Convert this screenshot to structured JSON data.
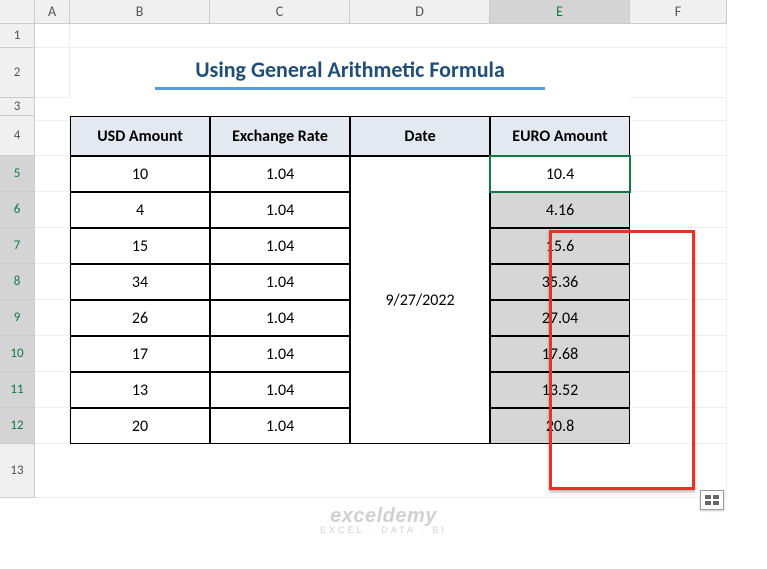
{
  "colHeaders": [
    "A",
    "B",
    "C",
    "D",
    "E",
    "F"
  ],
  "rowHeaders": [
    "1",
    "2",
    "3",
    "4",
    "5",
    "6",
    "7",
    "8",
    "9",
    "10",
    "11",
    "12",
    "13"
  ],
  "activeCol": "E",
  "activeRows": [
    "5",
    "6",
    "7",
    "8",
    "9",
    "10",
    "11",
    "12"
  ],
  "title": "Using General Arithmetic Formula",
  "tableHeaders": {
    "usd": "USD Amount",
    "rate": "Exchange Rate",
    "date": "Date",
    "euro": "EURO Amount"
  },
  "dateValue": "9/27/2022",
  "rows": [
    {
      "usd": "10",
      "rate": "1.04",
      "euro": "10.4"
    },
    {
      "usd": "4",
      "rate": "1.04",
      "euro": "4.16"
    },
    {
      "usd": "15",
      "rate": "1.04",
      "euro": "15.6"
    },
    {
      "usd": "34",
      "rate": "1.04",
      "euro": "35.36"
    },
    {
      "usd": "26",
      "rate": "1.04",
      "euro": "27.04"
    },
    {
      "usd": "17",
      "rate": "1.04",
      "euro": "17.68"
    },
    {
      "usd": "13",
      "rate": "1.04",
      "euro": "13.52"
    },
    {
      "usd": "20",
      "rate": "1.04",
      "euro": "20.8"
    }
  ],
  "watermark": {
    "line1": "exceldemy",
    "line2": "EXCEL · DATA · BI"
  },
  "chart_data": {
    "type": "table",
    "title": "Using General Arithmetic Formula",
    "columns": [
      "USD Amount",
      "Exchange Rate",
      "Date",
      "EURO Amount"
    ],
    "data": [
      [
        10,
        1.04,
        "9/27/2022",
        10.4
      ],
      [
        4,
        1.04,
        "9/27/2022",
        4.16
      ],
      [
        15,
        1.04,
        "9/27/2022",
        15.6
      ],
      [
        34,
        1.04,
        "9/27/2022",
        35.36
      ],
      [
        26,
        1.04,
        "9/27/2022",
        27.04
      ],
      [
        17,
        1.04,
        "9/27/2022",
        17.68
      ],
      [
        13,
        1.04,
        "9/27/2022",
        13.52
      ],
      [
        20,
        1.04,
        "9/27/2022",
        20.8
      ]
    ]
  }
}
